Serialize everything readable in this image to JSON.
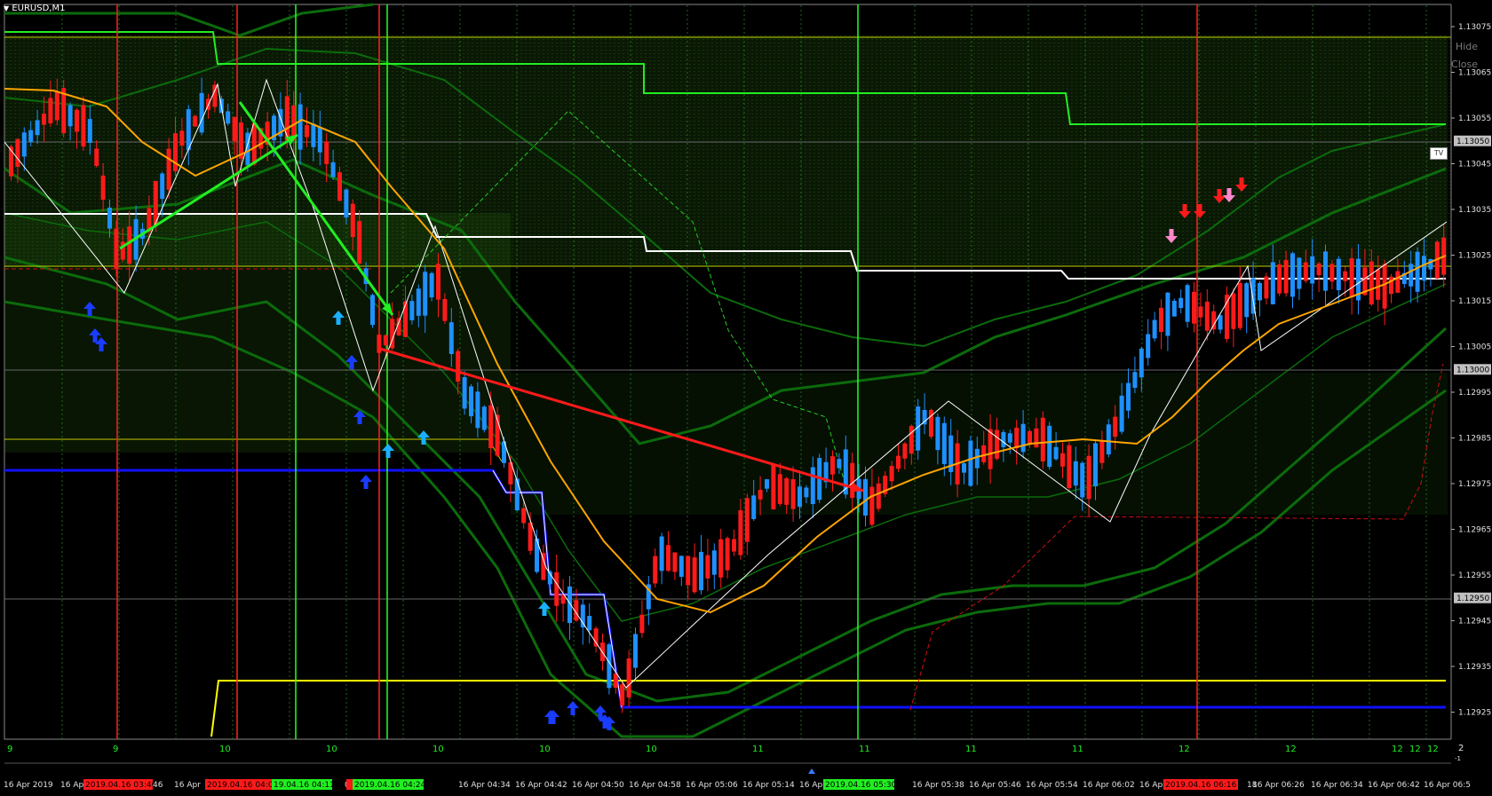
{
  "window": {
    "symbol_title": "EURUSD,M1"
  },
  "overlay_buttons": {
    "hide": "Hide",
    "close": "Close",
    "tv": "TV"
  },
  "colors": {
    "background": "#000000",
    "bull_candle": "#1e90ff",
    "bear_candle": "#ff1a1a",
    "ma": "#ffa500",
    "grid_green": "#00ff00",
    "bands": "#0b6b0b",
    "white_line": "#ffffff",
    "blue_support": "#1010ff",
    "yellow_line": "#ffff00",
    "arrow_up": "#1a3cff",
    "arrow_up_light": "#1ab0ff",
    "arrow_down": "#ff1a1a",
    "arrow_down_pink": "#ff88cc"
  },
  "price_axis": {
    "ticks": [
      "1.13075",
      "1.13065",
      "1.13055",
      "1.13045",
      "1.13035",
      "1.13025",
      "1.13015",
      "1.13005",
      "1.12995",
      "1.12985",
      "1.12975",
      "1.12965",
      "1.12955",
      "1.12945",
      "1.12935",
      "1.12925"
    ],
    "highlighted": [
      "1.13050",
      "1.13000",
      "1.12950"
    ]
  },
  "period_row": {
    "labels": [
      "9",
      "9",
      "10",
      "10",
      "10",
      "10",
      "10",
      "11",
      "11",
      "11",
      "11",
      "12",
      "12",
      "12",
      "12",
      "12"
    ],
    "right": "2",
    "right_small": "-1"
  },
  "time_axis": {
    "labels": [
      "16 Apr 2019",
      "16 Ap",
      "16 Apr",
      "16 Apr",
      "0",
      "04:26",
      "16 Apr 04:34",
      "16 Apr 04:42",
      "16 Apr 04:50",
      "16 Apr 04:58",
      "16 Apr 05:06",
      "16 Apr 05:14",
      "16 Apr",
      ":30",
      "16 Apr 05:38",
      "16 Apr 05:46",
      "16 Apr 05:54",
      "16 Apr 06:02",
      "16 Apr",
      "18",
      "16 Apr 06:26",
      "16 Apr 06:34",
      "16 Apr 06:42",
      "16 Apr 06:5"
    ],
    "red_badges": [
      "2019.04.16 03:46",
      "2019.04.16 04:03",
      "2019.04.16 06:16"
    ],
    "green_badges": [
      "19.04.16 04:11",
      "2019.04.16 04:24",
      "2019.04.16 05:30"
    ],
    "mixed_badge_text": "46"
  }
}
